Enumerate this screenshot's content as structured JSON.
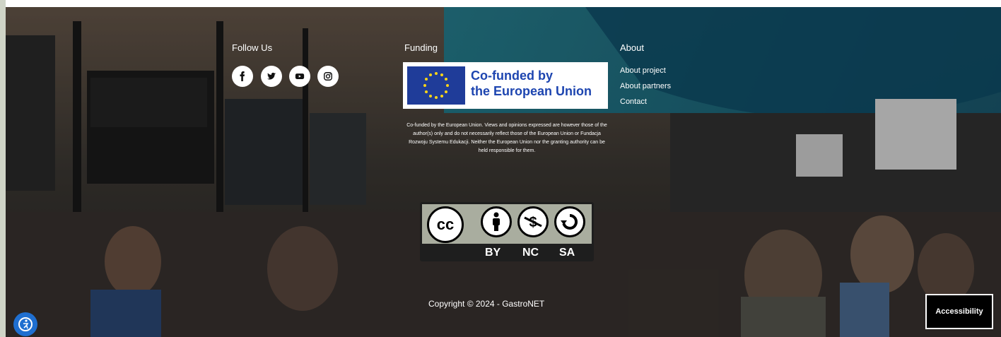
{
  "follow_us": {
    "title": "Follow Us",
    "icons": [
      "facebook-icon",
      "twitter-icon",
      "youtube-icon",
      "instagram-icon"
    ]
  },
  "funding": {
    "title": "Funding",
    "logo_line1": "Co-funded by",
    "logo_line2": "the European Union",
    "disclaimer": "Co-funded by the European Union. Views and opinions expressed are however those of the author(s) only and do not necessarily reflect those of the European Union or Fundacja Rozwoju Systemu Edukacji. Neither the European Union nor the granting authority can be held responsible for them."
  },
  "about": {
    "title": "About",
    "links": [
      "About project",
      "About partners",
      "Contact"
    ]
  },
  "license": {
    "badge_text": "cc",
    "by": "BY",
    "nc": "NC",
    "sa": "SA"
  },
  "copyright": "Copyright © 2024 - GastroNET",
  "accessibility": {
    "label": "Accessibility"
  },
  "colors": {
    "eu_blue": "#1f3c99",
    "eu_text": "#1d45b0",
    "accessibility_icon_bg": "#1f6fd0"
  }
}
